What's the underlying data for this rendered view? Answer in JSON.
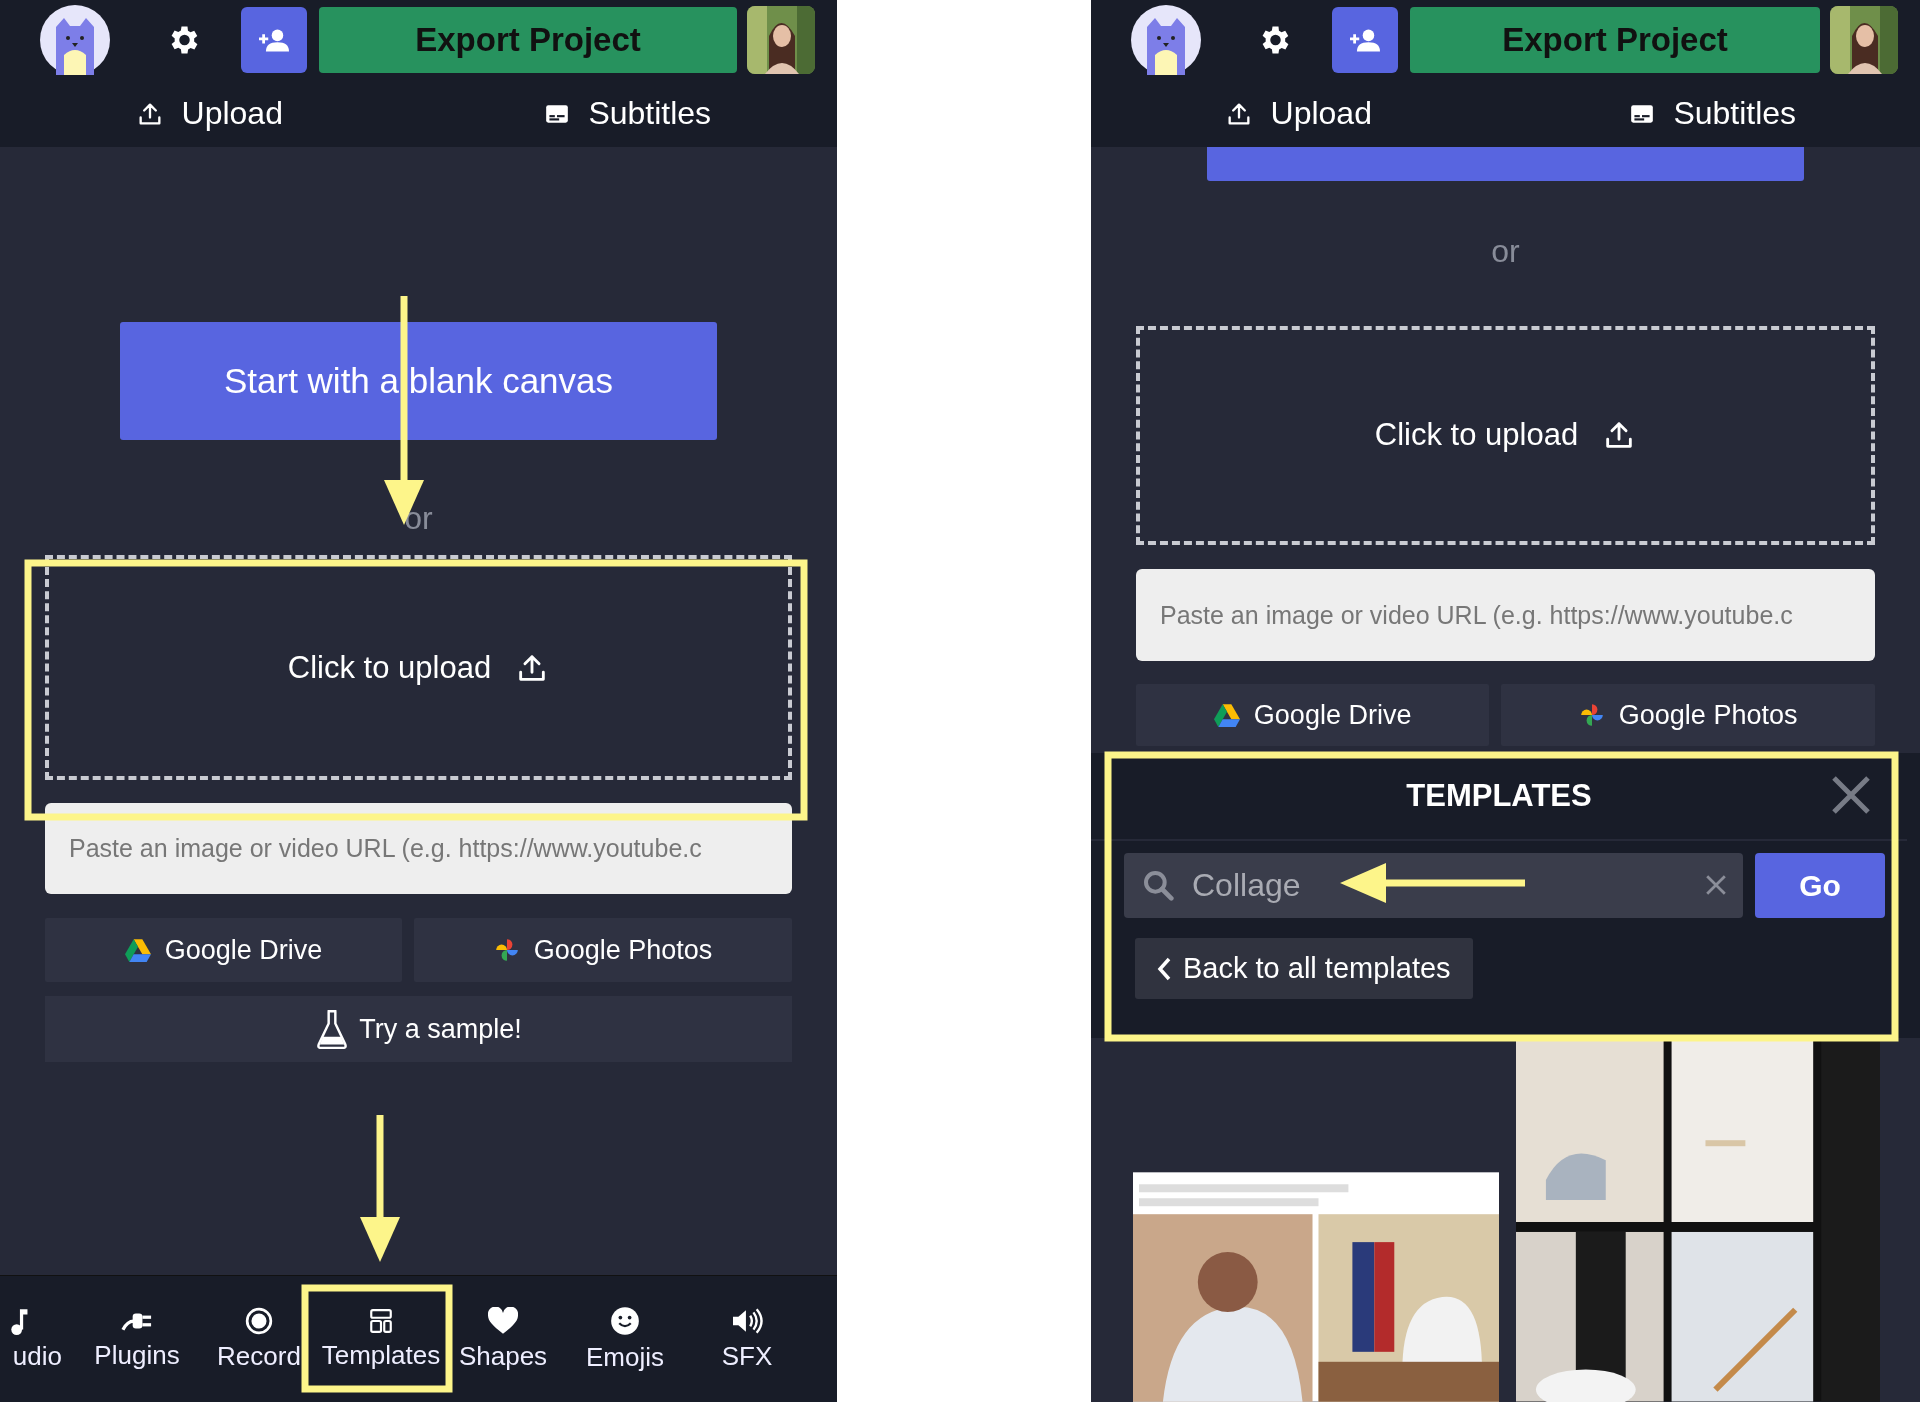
{
  "left_screen": {
    "header": {
      "export_button": "Export Project",
      "tabs": [
        {
          "label": "Upload",
          "kind": "upload"
        },
        {
          "label": "Subtitles",
          "kind": "subtitles"
        }
      ]
    },
    "blank_canvas_button": "Start with a blank canvas",
    "divider_text": "or",
    "upload_zone": {
      "label": "Click to upload"
    },
    "url_field": {
      "placeholder": "Paste an image or video URL (e.g. https://www.youtube.c"
    },
    "sources": [
      {
        "label": "Google Drive",
        "kind": "drive"
      },
      {
        "label": "Google Photos",
        "kind": "photos"
      }
    ],
    "sample_button": "Try a sample!",
    "bottom_nav": [
      {
        "label": "udio",
        "kind": "music"
      },
      {
        "label": "Plugins",
        "kind": "plug"
      },
      {
        "label": "Record",
        "kind": "record"
      },
      {
        "label": "Templates",
        "kind": "templates"
      },
      {
        "label": "Shapes",
        "kind": "heart"
      },
      {
        "label": "Emojis",
        "kind": "smiley"
      },
      {
        "label": "SFX",
        "kind": "speaker"
      }
    ]
  },
  "right_screen": {
    "header": {
      "export_button": "Export Project",
      "tabs": [
        {
          "label": "Upload",
          "kind": "upload"
        },
        {
          "label": "Subtitles",
          "kind": "subtitles"
        }
      ]
    },
    "divider_text": "or",
    "upload_zone": {
      "label": "Click to upload"
    },
    "url_field": {
      "placeholder": "Paste an image or video URL (e.g. https://www.youtube.c"
    },
    "sources": [
      {
        "label": "Google Drive",
        "kind": "drive"
      },
      {
        "label": "Google Photos",
        "kind": "photos"
      }
    ],
    "templates_panel": {
      "title": "TEMPLATES",
      "search": {
        "value": "Collage"
      },
      "go_button": "Go",
      "back_button": "Back to all templates"
    }
  }
}
